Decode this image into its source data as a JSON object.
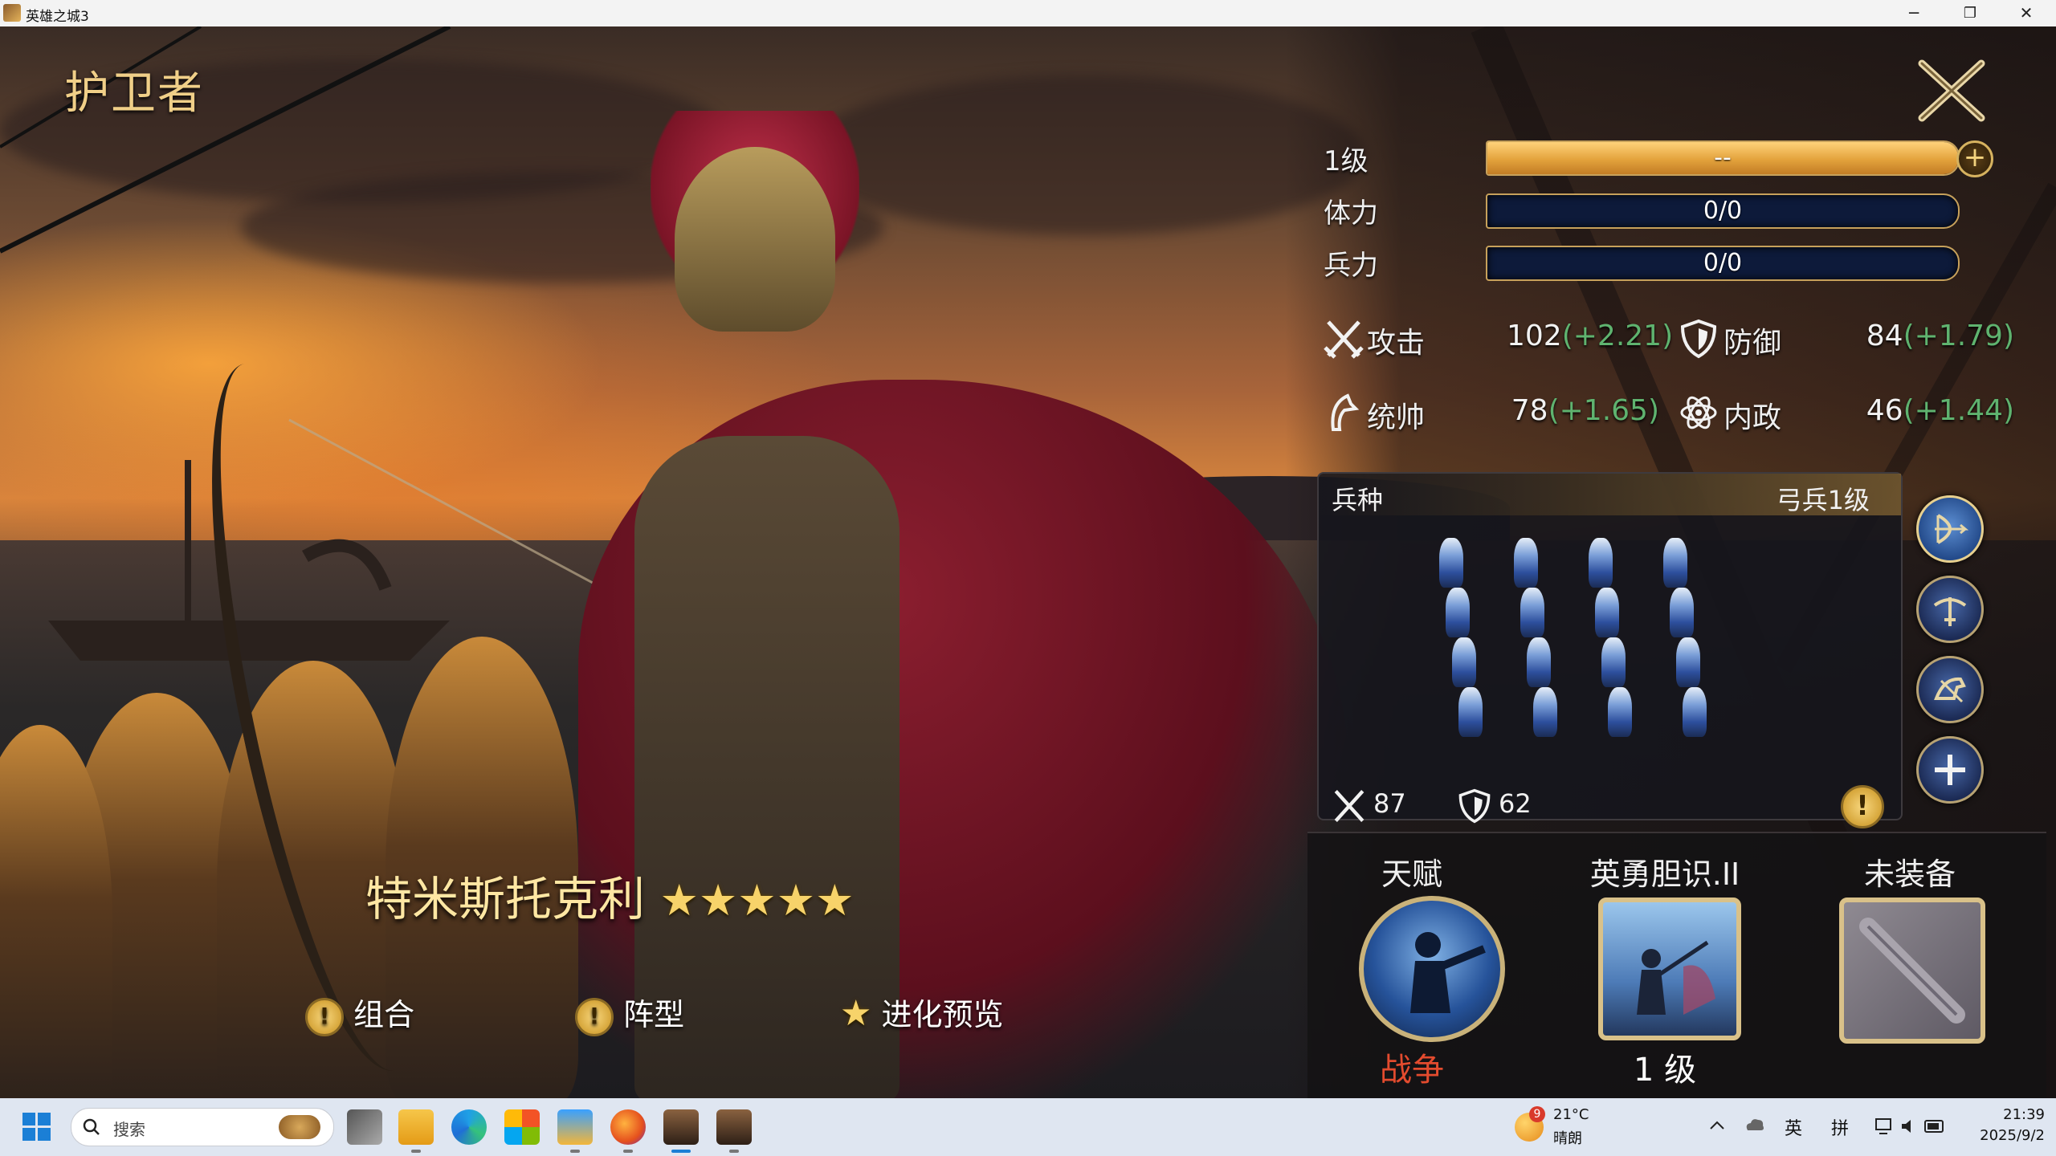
{
  "window": {
    "title": "英雄之城3",
    "controls": {
      "minimize": "─",
      "restore": "❐",
      "close": "✕"
    }
  },
  "page": {
    "title": "护卫者",
    "close_icon": "close-x-icon"
  },
  "stats": {
    "level_label": "1级",
    "level_value": "--",
    "level_progress": 1.0,
    "stamina_label": "体力",
    "stamina_value": "0/0",
    "troops_label": "兵力",
    "troops_value": "0/0"
  },
  "attributes": {
    "attack": {
      "label": "攻击",
      "value": "102",
      "bonus": "(+2.21)"
    },
    "defense": {
      "label": "防御",
      "value": "84",
      "bonus": "(+1.79)"
    },
    "command": {
      "label": "统帅",
      "value": "78",
      "bonus": "(+1.65)"
    },
    "politics": {
      "label": "内政",
      "value": "46",
      "bonus": "(+1.44)"
    }
  },
  "troop": {
    "label": "兵种",
    "type": "弓兵1级",
    "attack": "87",
    "defense": "62",
    "unit_tabs": [
      "archer-unit-icon",
      "crossbow-unit-icon",
      "horse-archer-unit-icon",
      "add-unit-icon"
    ],
    "selected_tab": 0
  },
  "equipment": {
    "talent": {
      "title": "天赋",
      "sub": "战争"
    },
    "skill": {
      "title": "英勇胆识.II",
      "sub": "1 级"
    },
    "gear": {
      "title": "未装备"
    }
  },
  "hero": {
    "name": "特米斯托克利",
    "stars": 5,
    "star_glyph": "★"
  },
  "bottom_links": {
    "combo": "组合",
    "formation": "阵型",
    "evolve": "进化预览",
    "warn_glyph": "!"
  },
  "taskbar": {
    "search_placeholder": "搜索",
    "weather_badge": "9",
    "weather_temp": "21°C",
    "weather_desc": "晴朗",
    "ime_lang": "英",
    "ime_mode": "拼",
    "time": "21:39",
    "date": "2025/9/2"
  },
  "colors": {
    "gold": "#f0cf88",
    "bonus_green": "#5fb36f",
    "war_red": "#e34b2e"
  }
}
